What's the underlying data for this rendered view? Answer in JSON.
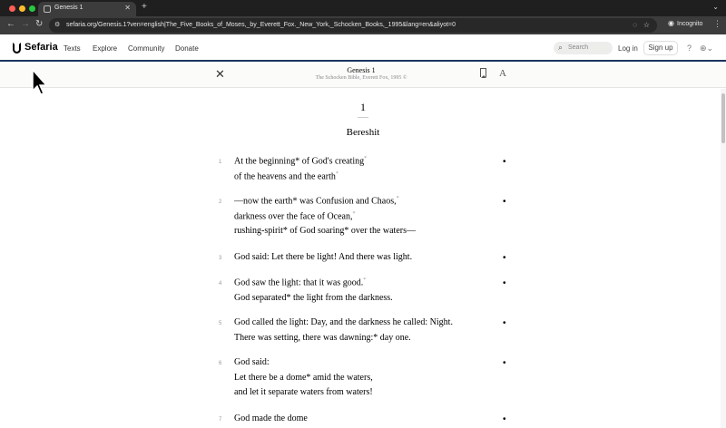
{
  "browser": {
    "tab_title": "Genesis 1",
    "new_tab": "+",
    "url": "sefaria.org/Genesis.1?ven=english|The_Five_Books_of_Moses,_by_Everett_Fox._New_York,_Schocken_Books,_1995&lang=en&aliyot=0",
    "incognito_label": "Incognito"
  },
  "site": {
    "logo": "Sefaria",
    "nav": [
      "Texts",
      "Explore",
      "Community",
      "Donate"
    ],
    "search_placeholder": "Search",
    "login": "Log in",
    "signup": "Sign up"
  },
  "reader": {
    "title": "Genesis 1",
    "subtitle": "The Schocken Bible, Everett Fox, 1995 ©",
    "font_toggle": "A"
  },
  "chapter": {
    "number": "1",
    "name": "Bereshit"
  },
  "verses": [
    {
      "num": "1",
      "lines": [
        "At the beginning|* of God's creating|*",
        "of the heavens and the earth|*"
      ]
    },
    {
      "num": "2",
      "lines": [
        "—now the earth|* was Confusion and Chaos,|*",
        "darkness over the face of Ocean,|*",
        "rushing-spirit|* of God soaring|* over the waters—"
      ]
    },
    {
      "num": "3",
      "lines": [
        "God said: Let there be light! And there was light."
      ]
    },
    {
      "num": "4",
      "lines": [
        "God saw the light: that it was good.|*",
        "God separated|* the light from the darkness."
      ]
    },
    {
      "num": "5",
      "lines": [
        "God called the light: Day, and the darkness he called: Night.",
        "There was setting, there was dawning:|* day one."
      ]
    },
    {
      "num": "6",
      "lines": [
        "God said:",
        "Let there be a dome|* amid the waters,",
        "and let it separate waters from waters!"
      ]
    },
    {
      "num": "7",
      "lines": [
        "God made the dome"
      ]
    }
  ],
  "footnote_marker": "*",
  "verse_dot": "•"
}
